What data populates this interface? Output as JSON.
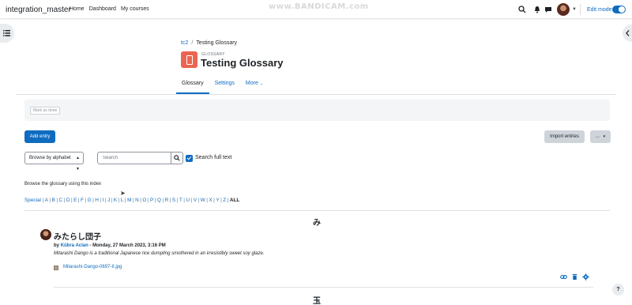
{
  "navbar": {
    "site_name": "integration_master",
    "links": [
      "Home",
      "Dashboard",
      "My courses"
    ],
    "edit_mode_label": "Edit mode"
  },
  "watermark": "www.BANDICAM.com",
  "breadcrumb": {
    "course": "tc2",
    "separator": "/",
    "current": "Testing Glossary"
  },
  "header": {
    "module_type": "GLOSSARY",
    "title": "Testing Glossary"
  },
  "tabs": [
    {
      "label": "Glossary"
    },
    {
      "label": "Settings"
    },
    {
      "label": "More"
    }
  ],
  "completion": {
    "mark_done_label": "Mark as done"
  },
  "actions": {
    "add_entry": "Add entry",
    "import_entries": "Import entries",
    "more": "..."
  },
  "filters": {
    "browse_select": "Browse by alphabet",
    "search_placeholder": "Search",
    "search_full_text_label": "Search full text"
  },
  "index": {
    "label": "Browse the glossary using this index",
    "letters": [
      "Special",
      "A",
      "B",
      "C",
      "D",
      "E",
      "F",
      "G",
      "H",
      "I",
      "J",
      "K",
      "L",
      "M",
      "N",
      "O",
      "P",
      "Q",
      "R",
      "S",
      "T",
      "U",
      "V",
      "W",
      "X",
      "Y",
      "Z"
    ],
    "all": "ALL"
  },
  "groups": [
    {
      "letter": "み"
    },
    {
      "letter": "玉"
    }
  ],
  "entry": {
    "title": "みたらし団子",
    "by": "by",
    "author": "Kübra Aclan",
    "date": " - Monday, 27 March 2023, 3:16 PM",
    "description": "Mitarashi Dango is a traditional Japanese rice dumpling smothered in an irresistibly sweet soy glaze.",
    "attachment": "Mitarashi-Dango-0697-II.jpg"
  },
  "help_label": "?",
  "colors": {
    "primary": "#0f6cbf",
    "module_icon": "#eb6551",
    "text": "#1d2125"
  }
}
